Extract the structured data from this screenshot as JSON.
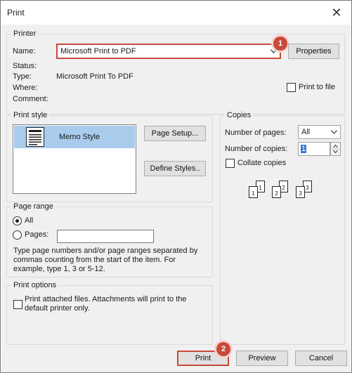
{
  "window": {
    "title": "Print",
    "close_glyph": "✕"
  },
  "printer": {
    "legend": "Printer",
    "name_label": "Name:",
    "name_value": "Microsoft Print to PDF",
    "properties_label": "Properties",
    "status_label": "Status:",
    "status_value": "",
    "type_label": "Type:",
    "type_value": "Microsoft Print To PDF",
    "where_label": "Where:",
    "comment_label": "Comment:",
    "print_to_file_label": "Print to file",
    "print_to_file_checked": false
  },
  "print_style": {
    "legend": "Print style",
    "items": [
      {
        "label": "Memo Style",
        "selected": true
      }
    ],
    "page_setup_label": "Page Setup...",
    "define_styles_label": "Define Styles.."
  },
  "copies": {
    "legend": "Copies",
    "num_pages_label": "Number of pages:",
    "num_pages_value": "All",
    "num_copies_label": "Number of copies:",
    "num_copies_value": "1",
    "collate_label": "Collate copies",
    "collate_checked": false,
    "collate_pages": [
      "1",
      "1",
      "2",
      "2",
      "3",
      "3"
    ]
  },
  "page_range": {
    "legend": "Page range",
    "all_label": "All",
    "pages_label": "Pages:",
    "pages_value": "",
    "help_text_line1": "Type page numbers and/or page ranges separated by",
    "help_text_line2": "commas counting from the start of the item.  For",
    "help_text_line3": "example, type 1, 3 or 5-12."
  },
  "print_options": {
    "legend": "Print options",
    "attach_label_line1": "Print attached files.  Attachments will print to the",
    "attach_label_line2": "default printer only.",
    "attach_checked": false
  },
  "footer": {
    "print_label": "Print",
    "preview_label": "Preview",
    "cancel_label": "Cancel"
  },
  "annotations": {
    "step1": "1",
    "step2": "2"
  },
  "colors": {
    "accent_red": "#c8493a",
    "selection_blue": "#a9cbec",
    "dialog_bg": "#f0f0f0"
  }
}
